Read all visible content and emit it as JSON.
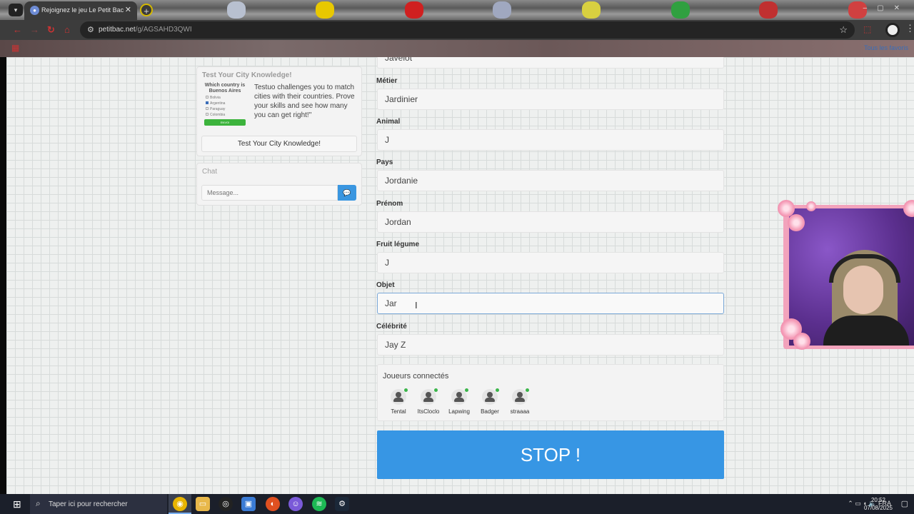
{
  "browser": {
    "tab_title": "Rejoignez le jeu Le Petit Bac",
    "url_host": "petitbac.net",
    "url_path": "/g/AGSAHD3QWI",
    "bookmarks_all": "Tous les favoris"
  },
  "ad": {
    "title": "Test Your City Knowledge!",
    "quiz_question": "Which country is Buenos Aires",
    "quiz_options": [
      "Bolivia",
      "Argentina",
      "Paraguay",
      "Colombia"
    ],
    "quiz_button": "ENVOI",
    "text": "Testuo challenges you to match cities with their countries. Prove your skills and see how many you can get right!\"",
    "button": "Test Your City Knowledge!"
  },
  "chat": {
    "title": "Chat",
    "placeholder": "Message..."
  },
  "fields": [
    {
      "label": "",
      "value": "Javelot"
    },
    {
      "label": "Métier",
      "value": "Jardinier"
    },
    {
      "label": "Animal",
      "value": "J"
    },
    {
      "label": "Pays",
      "value": "Jordanie"
    },
    {
      "label": "Prénom",
      "value": "Jordan"
    },
    {
      "label": "Fruit légume",
      "value": "J"
    },
    {
      "label": "Objet",
      "value": "Jar"
    },
    {
      "label": "Célébrité",
      "value": "Jay Z"
    }
  ],
  "players": {
    "title": "Joueurs connectés",
    "list": [
      "Tental",
      "ItsCloclo",
      "Lapwing",
      "Badger",
      "straaaa"
    ]
  },
  "stop_button": "STOP !",
  "taskbar": {
    "search_placeholder": "Taper ici pour rechercher",
    "lang": "FRA",
    "time": "20:52",
    "date": "07/08/2025"
  },
  "colors": {
    "stop_blue": "#3796e4",
    "online_green": "#3bb54a",
    "webcam_frame_pink": "#f2a3bc"
  }
}
